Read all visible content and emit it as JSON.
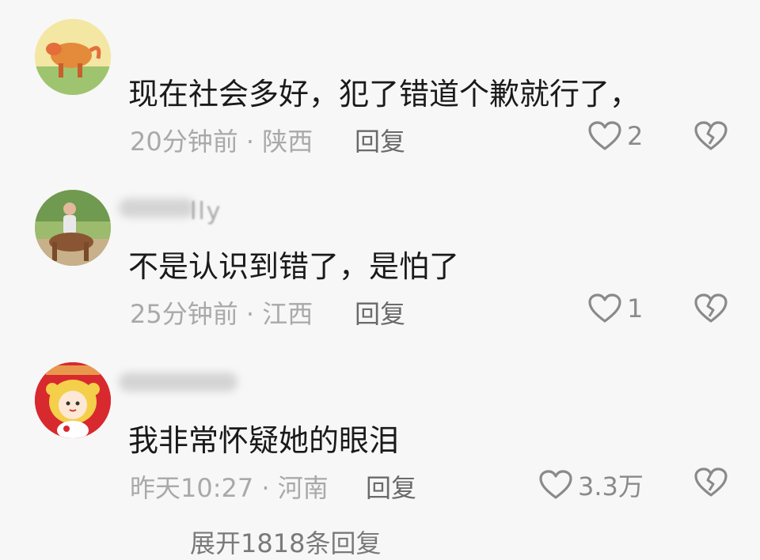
{
  "comments": [
    {
      "username": "",
      "text": "现在社会多好，犯了错道个歉就行了，",
      "time": "20分钟前",
      "location": "陕西",
      "reply_label": "回复",
      "likes": "2"
    },
    {
      "username": "lly",
      "text": "不是认识到错了，是怕了",
      "time": "25分钟前",
      "location": "江西",
      "reply_label": "回复",
      "likes": "1"
    },
    {
      "username": "",
      "text": "我非常怀疑她的眼泪",
      "time": "昨天10:27",
      "location": "河南",
      "reply_label": "回复",
      "likes": "3.3万"
    }
  ],
  "separator": "·",
  "expand_label": "展开1818条回复",
  "icons": {
    "like": "heart-outline-icon",
    "dislike": "broken-heart-icon"
  },
  "colors": {
    "background": "#f7f7f7",
    "text": "#1a1a1a",
    "meta": "#a9a9a9",
    "icon": "#8a8a8a"
  }
}
